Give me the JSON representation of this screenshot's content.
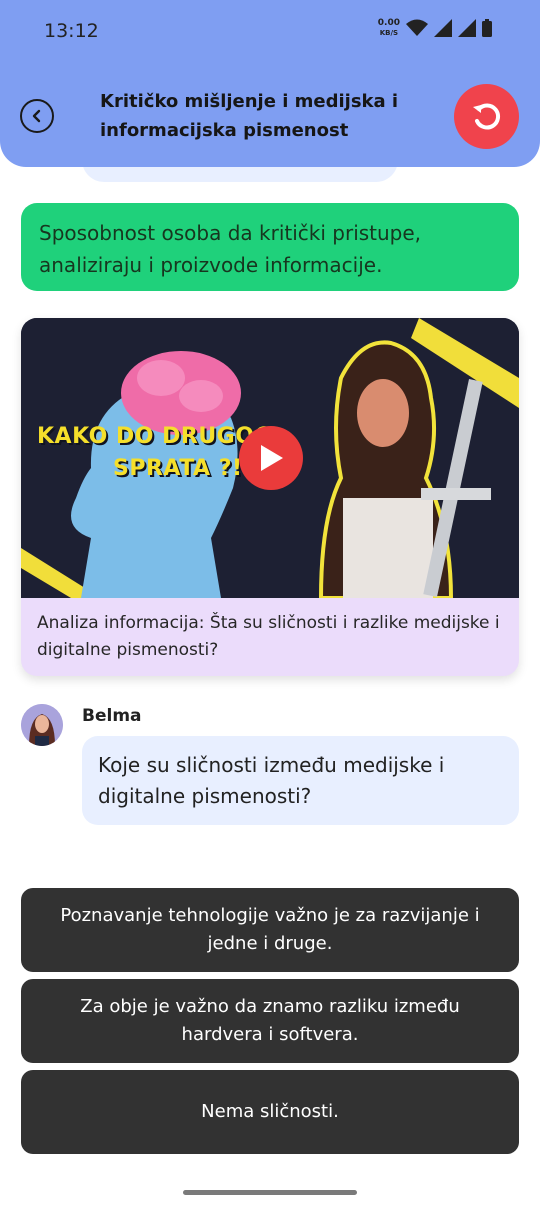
{
  "status_bar": {
    "time": "13:12",
    "net_speed_value": "0.00",
    "net_speed_unit": "KB/S",
    "icons": [
      "wifi-icon",
      "signal-icon",
      "signal-icon",
      "battery-icon"
    ]
  },
  "header": {
    "title": "Kritičko mišljenje i medijska i informacijska pismenost",
    "back_icon": "chevron-left-icon",
    "reset_icon": "restart-icon",
    "background_color": "#7f9ef2",
    "reset_color": "#f0434c"
  },
  "chat": {
    "answer_text": "Sposobnost osoba da kritički pristupe, analiziraju i proizvode informacije.",
    "answer_color": "#1fd17b",
    "video": {
      "thumbnail_text_line1": "KAKO DO DRUGOG",
      "thumbnail_text_line2": "SPRATA ?!",
      "caption": "Analiza informacija: Šta su sličnosti i razlike medijske i digitalne pismenosti?",
      "play_icon": "play-icon"
    },
    "author": "Belma",
    "question_text": "Koje su sličnosti između medijske i digitalne pismenosti?"
  },
  "options": [
    "Poznavanje tehnologije važno je za razvijanje i jedne i druge.",
    "Za obje je važno da znamo razliku između hardvera i softvera.",
    "Nema sličnosti."
  ]
}
